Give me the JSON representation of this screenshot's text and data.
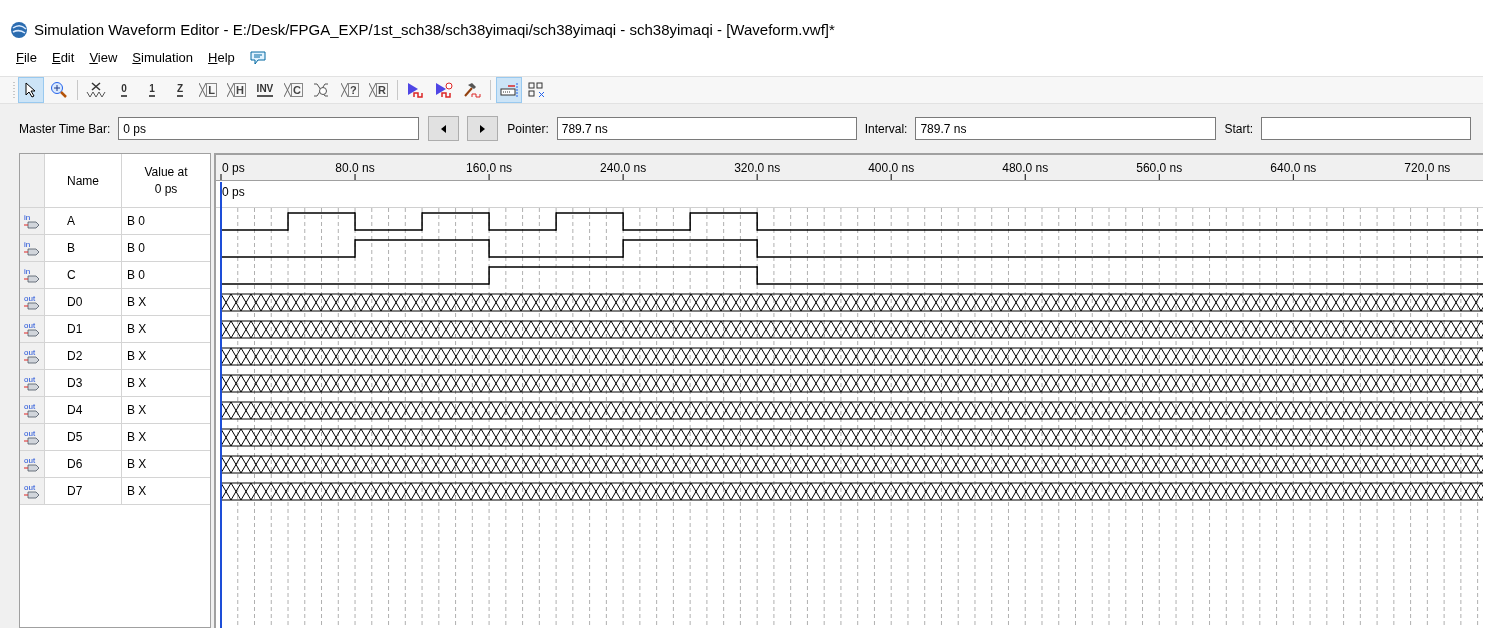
{
  "window": {
    "title": "Simulation Waveform Editor - E:/Desk/FPGA_EXP/1st_sch38/sch38yimaqi/sch38yimaqi - sch38yimaqi - [Waveform.vwf]*"
  },
  "menu": [
    "File",
    "Edit",
    "View",
    "Simulation",
    "Help"
  ],
  "toolbar": [
    {
      "kind": "pointer",
      "selected": true
    },
    {
      "kind": "zoom",
      "selected": false
    },
    {
      "kind": "sep"
    },
    {
      "kind": "unknown",
      "selected": false
    },
    {
      "kind": "level",
      "glyph": "0",
      "selected": false
    },
    {
      "kind": "level",
      "glyph": "1",
      "selected": false
    },
    {
      "kind": "level",
      "glyph": "Z",
      "selected": false
    },
    {
      "kind": "forcing",
      "glyph": "L",
      "selected": false
    },
    {
      "kind": "forcing",
      "glyph": "H",
      "selected": false
    },
    {
      "kind": "level",
      "glyph": "INV",
      "selected": false
    },
    {
      "kind": "forcing",
      "glyph": "C",
      "selected": false
    },
    {
      "kind": "timer",
      "selected": false
    },
    {
      "kind": "forcing",
      "glyph": "?",
      "selected": false
    },
    {
      "kind": "forcing",
      "glyph": "R",
      "selected": false
    },
    {
      "kind": "sep"
    },
    {
      "kind": "run",
      "selected": false
    },
    {
      "kind": "run-timed",
      "selected": false
    },
    {
      "kind": "hammer",
      "selected": false
    },
    {
      "kind": "sep"
    },
    {
      "kind": "snap",
      "selected": true
    },
    {
      "kind": "grid",
      "selected": false
    }
  ],
  "time_bar": {
    "master_label": "Master Time Bar:",
    "master_value": "0 ps",
    "pointer_label": "Pointer:",
    "pointer_value": "789.7 ns",
    "interval_label": "Interval:",
    "interval_value": "789.7 ns",
    "start_label": "Start:"
  },
  "table": {
    "columns": [
      "Name",
      "Value at\n0 ps"
    ],
    "rows": [
      {
        "io": "in",
        "name": "A",
        "value": "B 0"
      },
      {
        "io": "in",
        "name": "B",
        "value": "B 0"
      },
      {
        "io": "in",
        "name": "C",
        "value": "B 0"
      },
      {
        "io": "out",
        "name": "D0",
        "value": "B X"
      },
      {
        "io": "out",
        "name": "D1",
        "value": "B X"
      },
      {
        "io": "out",
        "name": "D2",
        "value": "B X"
      },
      {
        "io": "out",
        "name": "D3",
        "value": "B X"
      },
      {
        "io": "out",
        "name": "D4",
        "value": "B X"
      },
      {
        "io": "out",
        "name": "D5",
        "value": "B X"
      },
      {
        "io": "out",
        "name": "D6",
        "value": "B X"
      },
      {
        "io": "out",
        "name": "D7",
        "value": "B X"
      }
    ]
  },
  "waveform": {
    "ruler": [
      "0 ps",
      "80.0 ns",
      "160.0 ns",
      "240.0 ns",
      "320.0 ns",
      "400.0 ns",
      "480.0 ns",
      "560.0 ns",
      "640.0 ns",
      "720.0 ns"
    ],
    "cursor_label": "0 ps",
    "rows": [
      {
        "unknown": false,
        "high": [
          false,
          true,
          false,
          true,
          false,
          true,
          false,
          true,
          false,
          false,
          false,
          false,
          false,
          false,
          false,
          false,
          false,
          false,
          false
        ]
      },
      {
        "unknown": false,
        "high": [
          false,
          false,
          true,
          true,
          false,
          false,
          true,
          true,
          false,
          false,
          false,
          false,
          false,
          false,
          false,
          false,
          false,
          false,
          false
        ]
      },
      {
        "unknown": false,
        "high": [
          false,
          false,
          false,
          false,
          true,
          true,
          true,
          true,
          false,
          false,
          false,
          false,
          false,
          false,
          false,
          false,
          false,
          false,
          false
        ]
      },
      {
        "unknown": true
      },
      {
        "unknown": true
      },
      {
        "unknown": true
      },
      {
        "unknown": true
      },
      {
        "unknown": true
      },
      {
        "unknown": true
      },
      {
        "unknown": true
      },
      {
        "unknown": true
      }
    ]
  }
}
